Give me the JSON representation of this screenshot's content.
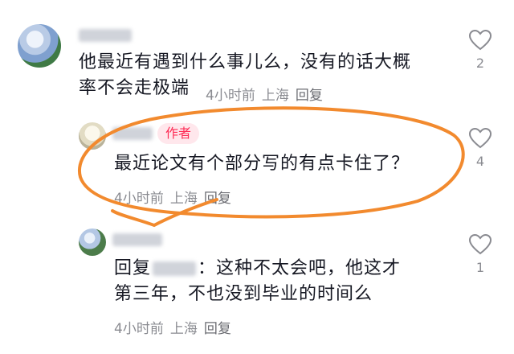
{
  "comments": [
    {
      "username": "",
      "text_line1": "他最近有遇到什么事儿么，没有的话大概",
      "text_line2_start": "率不会走极端",
      "time": "4小时前",
      "location": "上海",
      "reply_label": "回复",
      "likes": "2"
    },
    {
      "username": "",
      "badge": "作者",
      "text": "最近论文有个部分写的有点卡住了？",
      "time": "4小时前",
      "location": "上海",
      "reply_label": "回复",
      "likes": "4"
    },
    {
      "username": "",
      "reply_prefix": "回复",
      "reply_to": "",
      "text_after": "：这种不太会吧，他这才",
      "text_line2": "第三年，不也没到毕业的时间么",
      "time": "4小时前",
      "location": "上海",
      "reply_label": "回复",
      "likes": "1"
    }
  ],
  "icons": {
    "like": "heart-outline-icon"
  },
  "colors": {
    "text": "#161823",
    "meta": "#8a8b91",
    "author_badge": "#fe2c55",
    "author_badge_bg": "#ffe7ec",
    "annotation": "#f28a2e"
  }
}
